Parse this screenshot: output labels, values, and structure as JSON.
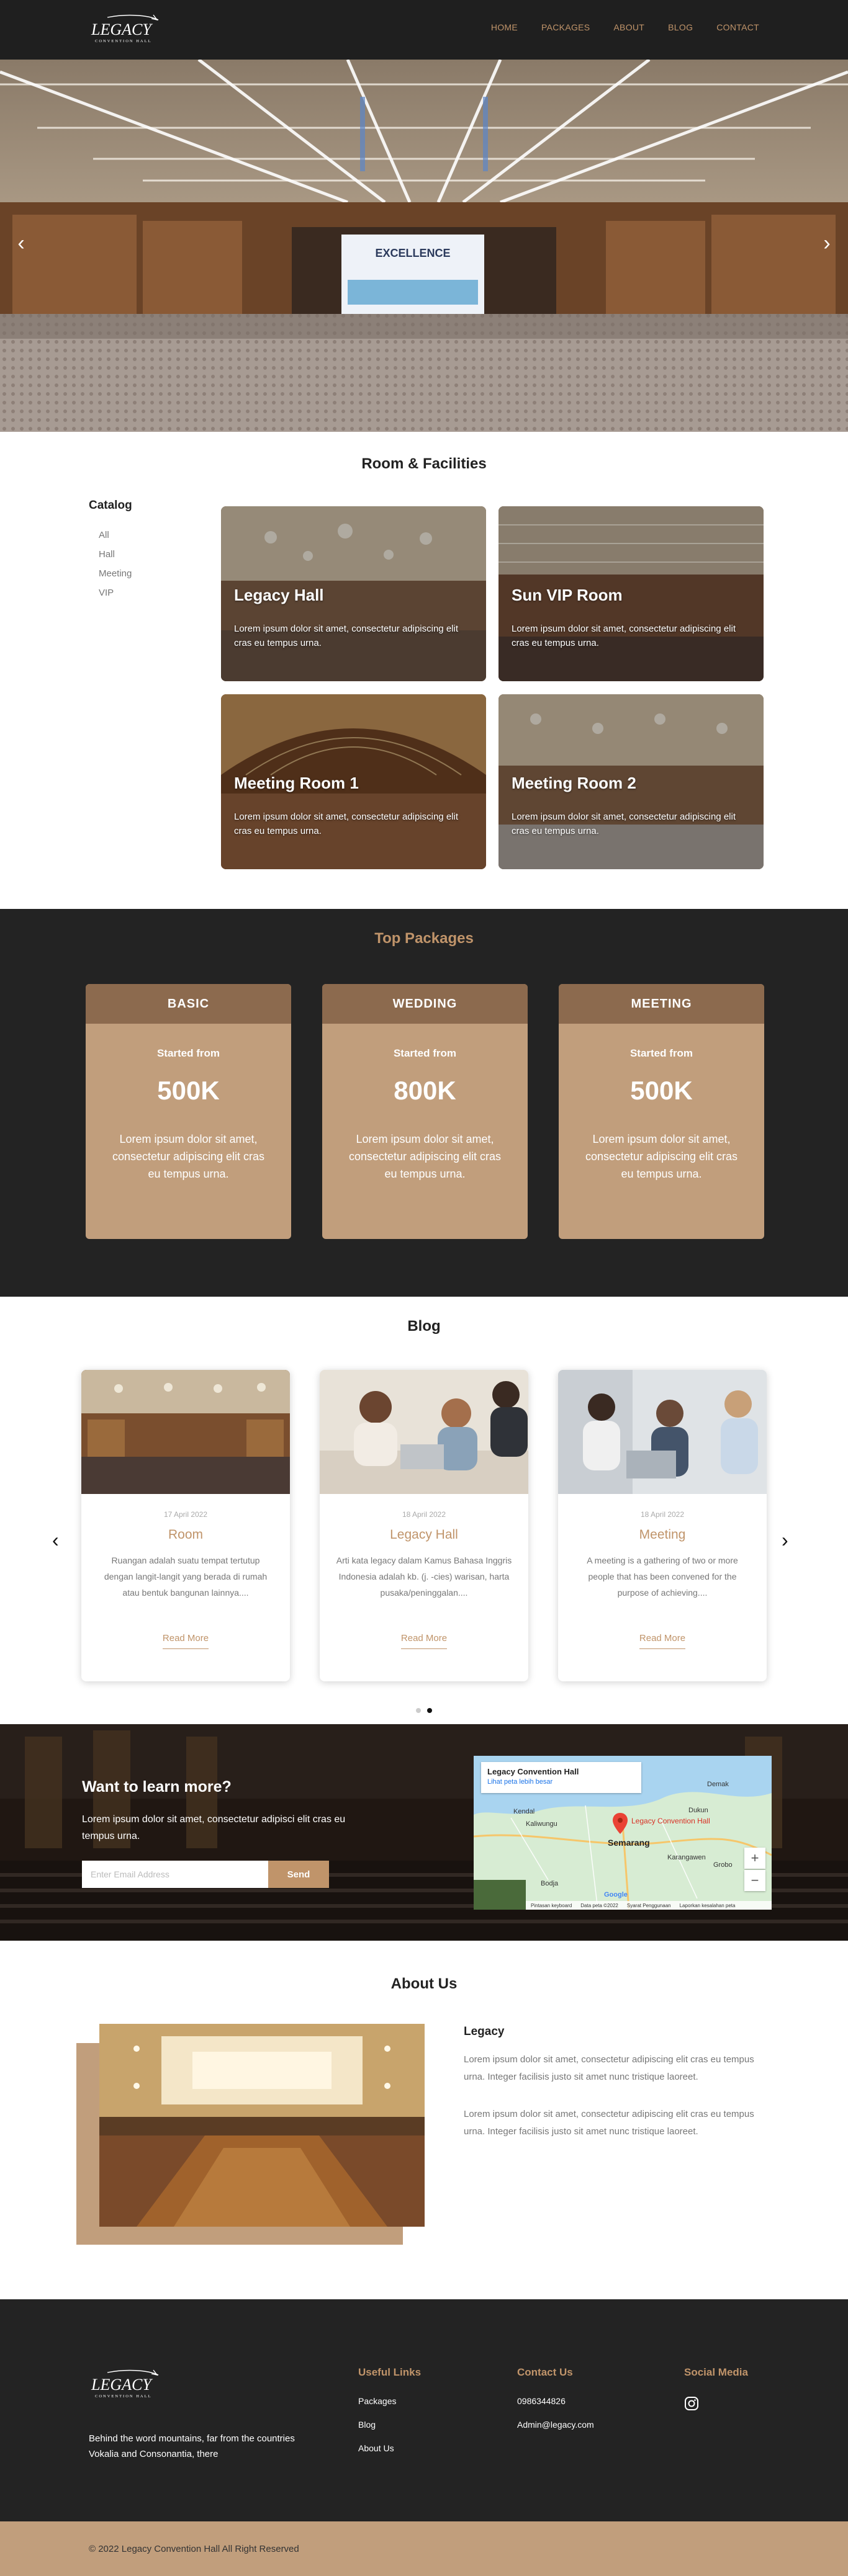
{
  "brand": {
    "name": "LEGACY",
    "subtitle": "CONVENTION HALL"
  },
  "nav": [
    {
      "label": "HOME"
    },
    {
      "label": "PACKAGES"
    },
    {
      "label": "ABOUT"
    },
    {
      "label": "BLOG"
    },
    {
      "label": "CONTACT"
    }
  ],
  "hero": {
    "screen_top": "EXCELLENCE"
  },
  "rooms": {
    "title": "Room & Facilities",
    "catalog_title": "Catalog",
    "catalog": [
      "All",
      "Hall",
      "Meeting",
      "VIP"
    ],
    "cards": [
      {
        "name": "Legacy Hall",
        "desc": "Lorem ipsum dolor sit amet, consectetur adipiscing elit cras eu tempus urna."
      },
      {
        "name": "Sun VIP Room",
        "desc": "Lorem ipsum dolor sit amet, consectetur adipiscing elit cras eu tempus urna."
      },
      {
        "name": "Meeting Room 1",
        "desc": "Lorem ipsum dolor sit amet, consectetur adipiscing elit cras eu tempus urna."
      },
      {
        "name": "Meeting Room 2",
        "desc": "Lorem ipsum dolor sit amet, consectetur adipiscing elit cras eu tempus urna."
      }
    ]
  },
  "packages": {
    "title": "Top Packages",
    "items": [
      {
        "name": "BASIC",
        "from": "Started from",
        "price": "500K",
        "desc": "Lorem ipsum dolor sit amet, consectetur adipiscing elit cras eu tempus urna."
      },
      {
        "name": "WEDDING",
        "from": "Started from",
        "price": "800K",
        "desc": "Lorem ipsum dolor sit amet, consectetur adipiscing elit cras eu tempus urna."
      },
      {
        "name": "MEETING",
        "from": "Started from",
        "price": "500K",
        "desc": "Lorem ipsum dolor sit amet, consectetur adipiscing elit cras eu tempus urna."
      }
    ]
  },
  "blog": {
    "title": "Blog",
    "posts": [
      {
        "date": "17 April 2022",
        "title": "Room",
        "excerpt": "Ruangan adalah suatu tempat tertutup dengan langit-langit yang berada di rumah atau bentuk bangunan lainnya....",
        "more": "Read More"
      },
      {
        "date": "18 April 2022",
        "title": "Legacy Hall",
        "excerpt": "Arti kata legacy dalam Kamus Bahasa Inggris Indonesia adalah kb. (j. -cies) warisan, harta pusaka/peninggalan....",
        "more": "Read More"
      },
      {
        "date": "18 April 2022",
        "title": "Meeting",
        "excerpt": "A meeting is a gathering of two or more people that has been convened for the purpose of achieving....",
        "more": "Read More"
      }
    ]
  },
  "newsletter": {
    "title": "Want to learn more?",
    "text": "Lorem ipsum dolor sit amet, consectetur adipisci elit cras eu tempus urna.",
    "placeholder": "Enter Email Address",
    "button": "Send",
    "map": {
      "place": "Legacy Convention Hall",
      "link": "Lihat peta lebih besar",
      "city": "Semarang",
      "labels": [
        "Kendal",
        "Kaliwungu",
        "Demak",
        "Dukun",
        "Karangawen",
        "Grobo",
        "Bodja"
      ],
      "footer": [
        "Pintasan keyboard",
        "Data peta ©2022",
        "Syarat Penggunaan",
        "Laporkan kesalahan peta"
      ],
      "google": "Google"
    }
  },
  "about": {
    "title": "About Us",
    "heading": "Legacy",
    "p1": "Lorem ipsum dolor sit amet, consectetur adipiscing elit cras eu tempus urna. Integer facilisis justo sit amet nunc tristique laoreet.",
    "p2": "Lorem ipsum dolor sit amet, consectetur adipiscing elit cras eu tempus urna. Integer facilisis justo sit amet nunc tristique laoreet."
  },
  "footer": {
    "tagline": "Behind the word mountains, far from the countries Vokalia and Consonantia, there",
    "useful_title": "Useful Links",
    "useful": [
      "Packages",
      "Blog",
      "About Us"
    ],
    "contact_title": "Contact Us",
    "contact": [
      "0986344826",
      "Admin@legacy.com"
    ],
    "social_title": "Social Media",
    "social_icon": "instagram-icon",
    "copyright": "© 2022 Legacy Convention Hall All Right Reserved"
  },
  "colors": {
    "accent": "#c0946a",
    "dark": "#232323",
    "card": "#c19e7c",
    "card_head": "#8c6a4e"
  }
}
